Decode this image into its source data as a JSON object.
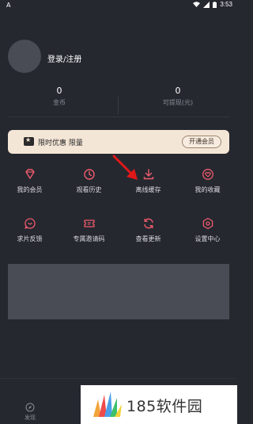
{
  "status_bar": {
    "left_glyph": "A",
    "time": "3:53"
  },
  "profile": {
    "login_label": "登录/注册"
  },
  "stats": [
    {
      "value": "0",
      "label": "金币"
    },
    {
      "value": "0",
      "label": "可提现(元)"
    }
  ],
  "vip_banner": {
    "promo_text": "限时优惠 限量",
    "button_label": "开通会员"
  },
  "menu": [
    {
      "icon": "diamond-icon",
      "label": "我的会员"
    },
    {
      "icon": "clock-icon",
      "label": "观看历史"
    },
    {
      "icon": "download-icon",
      "label": "离线缓存"
    },
    {
      "icon": "heart-icon",
      "label": "我的收藏"
    },
    {
      "icon": "feedback-icon",
      "label": "求片反馈"
    },
    {
      "icon": "ticket-icon",
      "label": "专属邀请码"
    },
    {
      "icon": "refresh-icon",
      "label": "查看更新"
    },
    {
      "icon": "settings-icon",
      "label": "设置中心"
    }
  ],
  "bottom_nav": {
    "discover_label": "发现"
  },
  "watermark": {
    "text": "185软件园"
  },
  "colors": {
    "background": "#262830",
    "accent_red": "#ef5b6b",
    "banner_bg": "#f4e6d6",
    "placeholder": "#4a4c55"
  }
}
